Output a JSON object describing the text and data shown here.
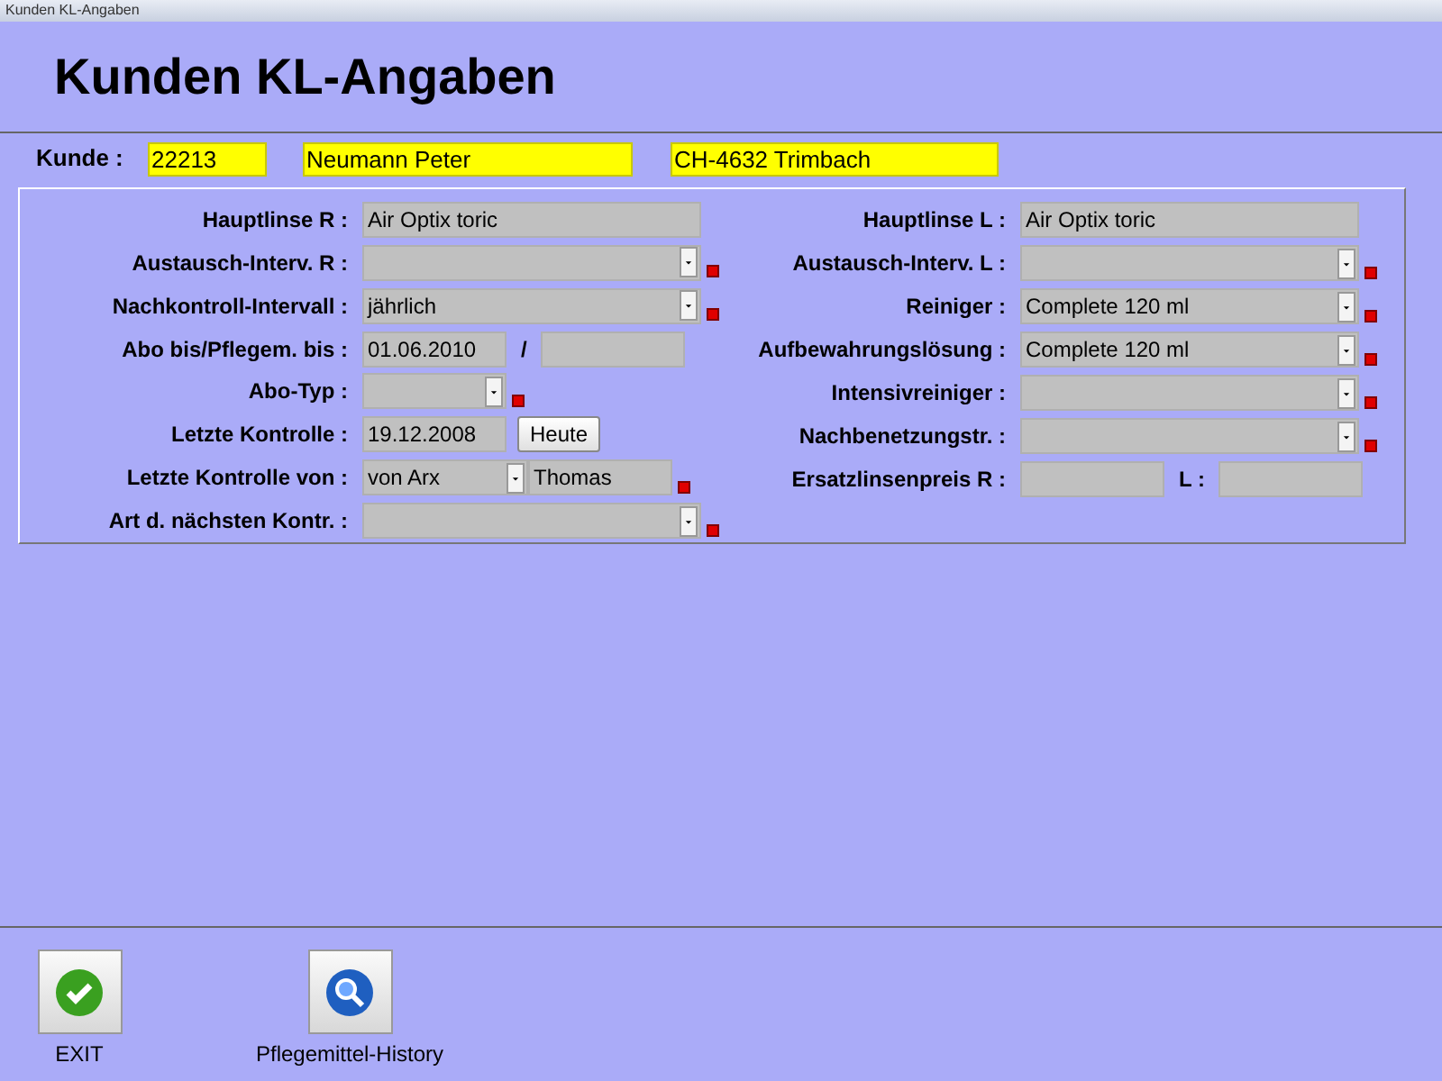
{
  "window": {
    "title": "Kunden KL-Angaben"
  },
  "heading": "Kunden KL-Angaben",
  "customer": {
    "label": "Kunde :",
    "number": "22213",
    "name": "Neumann Peter",
    "place": "CH-4632 Trimbach"
  },
  "columns": [
    {
      "rows": [
        {
          "label": "Hauptlinse R :",
          "required": false,
          "controls": [
            {
              "kind": "field",
              "value": "Air Optix toric"
            }
          ]
        },
        {
          "label": "Austausch-Interv. R :",
          "required": true,
          "controls": [
            {
              "kind": "dropdown"
            }
          ]
        },
        {
          "label": "Nachkontroll-Intervall :",
          "required": true,
          "controls": [
            {
              "kind": "dropdown",
              "value": "jährlich"
            }
          ]
        },
        {
          "label": "Abo bis/Pflegem. bis :",
          "required": false,
          "controls": [
            {
              "kind": "short-field",
              "value": "01.06.2010"
            },
            {
              "kind": "text",
              "value": "/"
            },
            {
              "kind": "short-field"
            }
          ]
        },
        {
          "label": "Abo-Typ :",
          "required": true,
          "controls": [
            {
              "kind": "short-dropdown"
            }
          ]
        },
        {
          "label": "Letzte Kontrolle :",
          "required": false,
          "controls": [
            {
              "kind": "short-field",
              "value": "19.12.2008"
            },
            {
              "kind": "button",
              "value": "Heute"
            }
          ]
        },
        {
          "label": "Letzte Kontrolle von :",
          "required": true,
          "controls": [
            {
              "kind": "short-dropdown",
              "value": "von Arx"
            },
            {
              "kind": "short-field",
              "value": "Thomas"
            }
          ]
        },
        {
          "label": "Art d. nächsten Kontr. :",
          "required": true,
          "controls": [
            {
              "kind": "dropdown"
            }
          ]
        }
      ]
    },
    {
      "rows": [
        {
          "label": "Hauptlinse L :",
          "required": false,
          "controls": [
            {
              "kind": "field",
              "value": "Air Optix toric"
            }
          ]
        },
        {
          "label": "Austausch-Interv. L :",
          "required": true,
          "controls": [
            {
              "kind": "dropdown"
            }
          ]
        },
        {
          "label": "Reiniger :",
          "required": true,
          "controls": [
            {
              "kind": "dropdown",
              "value": "Complete 120 ml"
            }
          ]
        },
        {
          "label": "Aufbewahrungslösung :",
          "required": true,
          "controls": [
            {
              "kind": "dropdown",
              "value": "Complete 120 ml"
            }
          ]
        },
        {
          "label": "Intensivreiniger :",
          "required": true,
          "controls": [
            {
              "kind": "dropdown"
            }
          ]
        },
        {
          "label": "Nachbenetzungstr. :",
          "required": true,
          "controls": [
            {
              "kind": "dropdown"
            }
          ]
        },
        {
          "label": "Ersatzlinsenpreis R :",
          "required": false,
          "controls": [
            {
              "kind": "short-field"
            },
            {
              "kind": "text",
              "value": "L :"
            },
            {
              "kind": "short-field"
            }
          ]
        }
      ]
    }
  ],
  "actions": [
    {
      "kind": "exit",
      "label": "EXIT"
    },
    {
      "kind": "history",
      "label": "Pflegemittel-History"
    }
  ]
}
